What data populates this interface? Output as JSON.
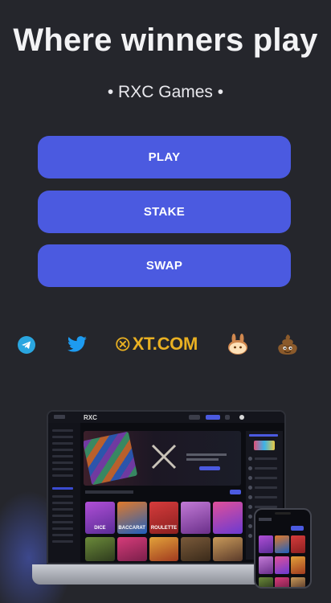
{
  "hero": {
    "title": "Where winners play",
    "subtitle": "• RXC Games •"
  },
  "buttons": {
    "play": "PLAY",
    "stake": "STAKE",
    "swap": "SWAP"
  },
  "partners": {
    "xt_label": "XT.COM",
    "icons": [
      "telegram-icon",
      "twitter-icon",
      "xt-com-logo",
      "pancakeswap-icon",
      "poop-emoji-icon"
    ]
  },
  "preview": {
    "laptop_logo": "RXC",
    "tiles": [
      "DICE",
      "BACCARAT",
      "ROULETTE",
      "",
      ""
    ]
  },
  "colors": {
    "background": "#25262c",
    "button": "#4b5ae0",
    "telegram": "#2aa6e0",
    "twitter": "#1d9bf0",
    "xt": "#e9b022"
  }
}
